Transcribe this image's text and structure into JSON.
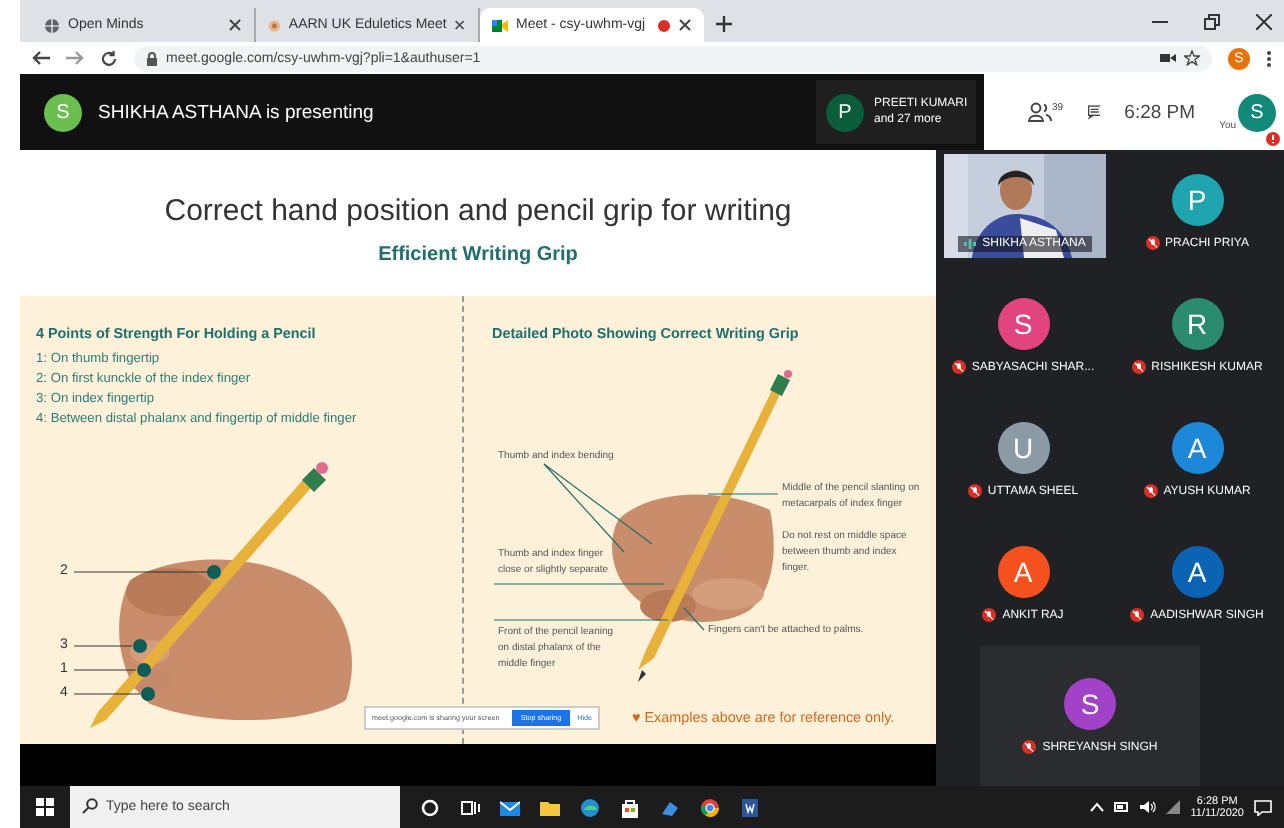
{
  "browser": {
    "tabs": [
      {
        "title": "Open Minds",
        "selected": false,
        "recording": false
      },
      {
        "title": "AARN UK Eduletics Meet",
        "selected": false,
        "recording": false
      },
      {
        "title": "Meet - csy-uwhm-vgj",
        "selected": true,
        "recording": true
      }
    ],
    "address": "meet.google.com/csy-uwhm-vgj?pli=1&authuser=1",
    "profile_initial": "S"
  },
  "meeting": {
    "presenter_initial": "S",
    "presenting_text": "SHIKHA ASTHANA is presenting",
    "pinned": {
      "initial": "P",
      "name": "PREETI KUMARI",
      "more": "and 27 more"
    },
    "people_count": "39",
    "time": "6:28 PM",
    "you_label": "You",
    "you_initial": "S"
  },
  "slide": {
    "title": "Correct hand position and pencil grip for writing",
    "subtitle": "Efficient Writing Grip",
    "left": {
      "heading": "4 Points of Strength For Holding a Pencil",
      "points": [
        "1: On thumb fingertip",
        "2: On first kunckle of the index finger",
        "3: On index fingertip",
        "4: Between distal phalanx and fingertip of middle finger"
      ],
      "markers": [
        "2",
        "3",
        "1",
        "4"
      ]
    },
    "right": {
      "heading": "Detailed Photo Showing Correct Writing Grip",
      "notes": [
        "Thumb and index bending",
        "Middle of the pencil slanting on metacarpals of index finger",
        "Thumb and index finger close or slightly separate",
        "Do not rest on middle space between thumb and index finger.",
        "Front of the pencil leaning on distal phalanx of the middle finger",
        "Fingers can't be attached to palms."
      ],
      "footnote": "♥ Examples above are for reference only."
    }
  },
  "sharing_bar": {
    "message": "meet.google.com is sharing your screen",
    "stop": "Stop sharing",
    "hide": "Hide"
  },
  "participants": [
    {
      "kind": "video",
      "name": "SHIKHA ASTHANA",
      "muted": false
    },
    {
      "kind": "avatar",
      "initial": "P",
      "name": "PRACHI PRIYA",
      "color": "#1ea5b0",
      "muted": true
    },
    {
      "kind": "avatar",
      "initial": "S",
      "name": "SABYASACHI SHAR...",
      "color": "#e2457d",
      "muted": true
    },
    {
      "kind": "avatar",
      "initial": "R",
      "name": "RISHIKESH KUMAR",
      "color": "#2a8c6c",
      "muted": true
    },
    {
      "kind": "avatar",
      "initial": "U",
      "name": "UTTAMA SHEEL",
      "color": "#8a9ba5",
      "muted": true
    },
    {
      "kind": "avatar",
      "initial": "A",
      "name": "AYUSH KUMAR",
      "color": "#1e88d8",
      "muted": true
    },
    {
      "kind": "avatar",
      "initial": "A",
      "name": "ANKIT RAJ",
      "color": "#f4511e",
      "muted": true
    },
    {
      "kind": "avatar",
      "initial": "A",
      "name": "AADISHWAR SINGH",
      "color": "#0b63b3",
      "muted": true
    },
    {
      "kind": "avatar",
      "initial": "S",
      "name": "SHREYANSH SINGH",
      "color": "#a142c9",
      "muted": true
    }
  ],
  "taskbar": {
    "search_placeholder": "Type here to search",
    "time": "6:28 PM",
    "date": "11/11/2020"
  }
}
